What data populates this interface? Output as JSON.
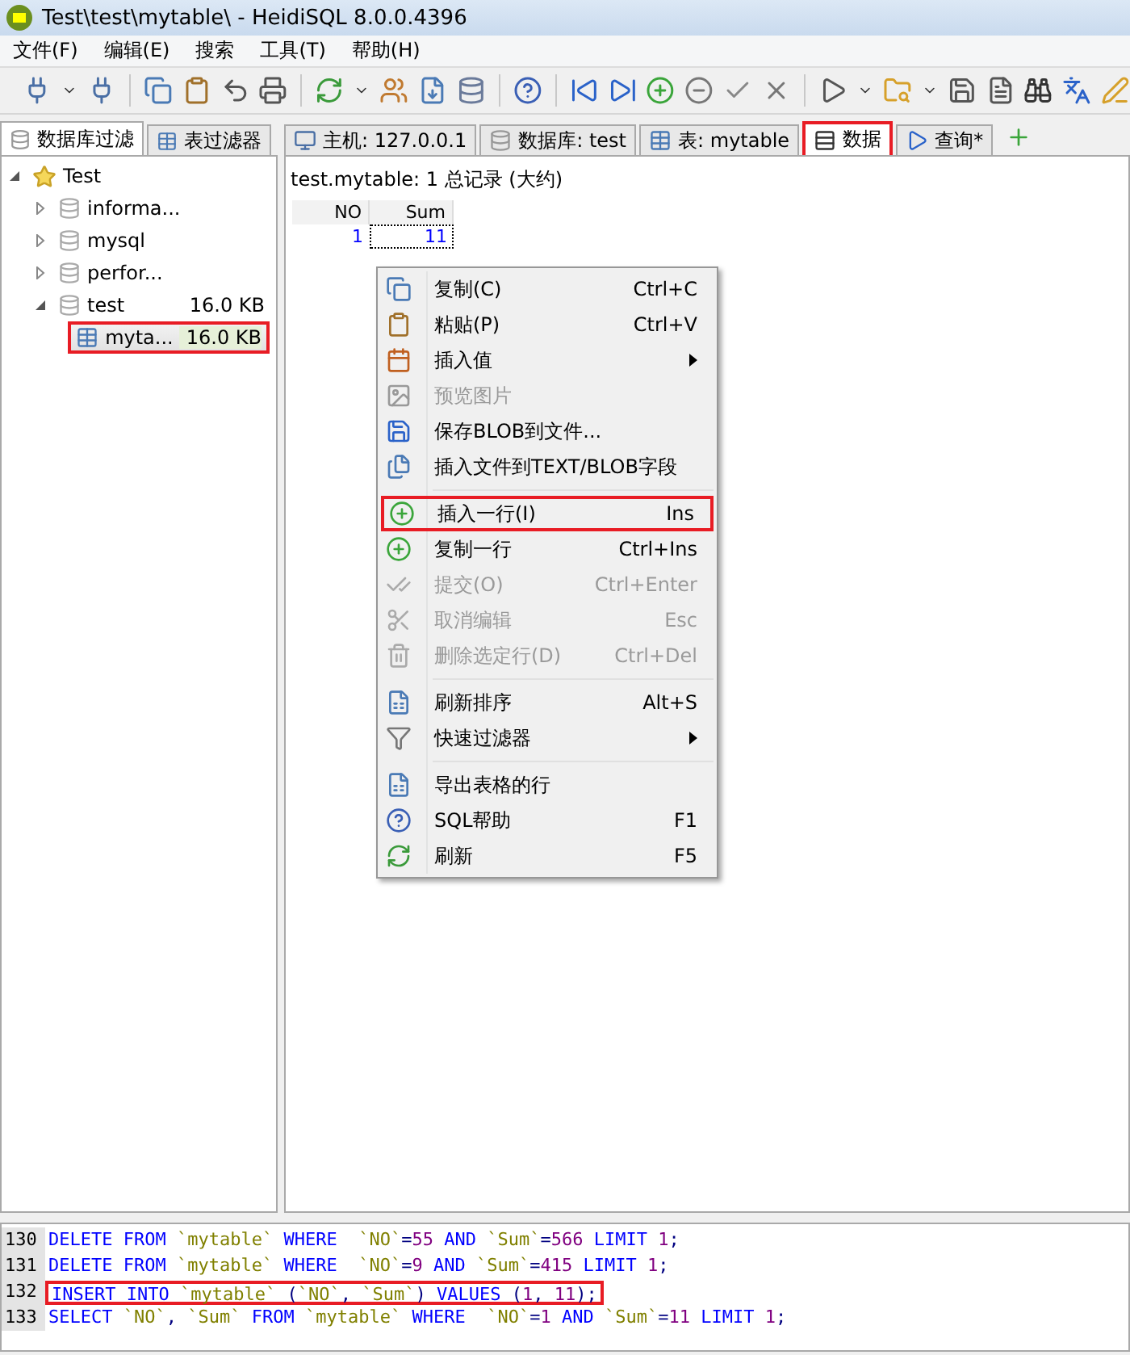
{
  "window": {
    "title": "Test\\test\\mytable\\ - HeidiSQL 8.0.0.4396"
  },
  "menu": [
    "文件(F)",
    "编辑(E)",
    "搜索",
    "工具(T)",
    "帮助(H)"
  ],
  "left_tabs": [
    {
      "label": "数据库过滤",
      "selected": true
    },
    {
      "label": "表过滤器",
      "selected": false
    }
  ],
  "tree": [
    {
      "label": "Test",
      "kind": "server",
      "expanded": true,
      "selected": false,
      "children": [
        {
          "label": "informa...",
          "kind": "database",
          "expanded": false,
          "selected": false
        },
        {
          "label": "mysql",
          "kind": "database",
          "expanded": false,
          "selected": false
        },
        {
          "label": "perfor...",
          "kind": "database",
          "expanded": false,
          "selected": false
        },
        {
          "label": "test",
          "size": "16.0 KB",
          "kind": "database",
          "expanded": true,
          "selected": false,
          "children": [
            {
              "label": "myta...",
              "size": "16.0 KB",
              "kind": "table",
              "selected": true,
              "highlighted": true
            }
          ]
        }
      ]
    }
  ],
  "tabs": [
    {
      "label": "主机: 127.0.0.1",
      "kind": "host",
      "selected": false,
      "highlighted": false
    },
    {
      "label": "数据库: test",
      "kind": "database",
      "selected": false,
      "highlighted": false
    },
    {
      "label": "表: mytable",
      "kind": "table",
      "selected": false,
      "highlighted": false
    },
    {
      "label": "数据",
      "kind": "data",
      "selected": true,
      "highlighted": true
    },
    {
      "label": "查询*",
      "kind": "query",
      "selected": false,
      "highlighted": false
    }
  ],
  "grid": {
    "caption": "test.mytable: 1 总记录 (大约)",
    "columns": [
      "NO",
      "Sum"
    ],
    "rows": [
      [
        "1",
        "11"
      ]
    ]
  },
  "context_menu": [
    {
      "kind": "item",
      "label": "复制(C)",
      "shortcut": "Ctrl+C",
      "disabled": false,
      "submenu": false,
      "highlighted": false
    },
    {
      "kind": "item",
      "label": "粘贴(P)",
      "shortcut": "Ctrl+V",
      "disabled": false,
      "submenu": false,
      "highlighted": false
    },
    {
      "kind": "item",
      "label": "插入值",
      "disabled": false,
      "submenu": true,
      "highlighted": false
    },
    {
      "kind": "item",
      "label": "预览图片",
      "disabled": true,
      "submenu": false,
      "highlighted": false
    },
    {
      "kind": "item",
      "label": "保存BLOB到文件...",
      "disabled": false,
      "submenu": false,
      "highlighted": false
    },
    {
      "kind": "item",
      "label": "插入文件到TEXT/BLOB字段",
      "disabled": false,
      "submenu": false,
      "highlighted": false
    },
    {
      "kind": "separator"
    },
    {
      "kind": "item",
      "label": "插入一行(I)",
      "shortcut": "Ins",
      "disabled": false,
      "submenu": false,
      "highlighted": true
    },
    {
      "kind": "item",
      "label": "复制一行",
      "shortcut": "Ctrl+Ins",
      "disabled": false,
      "submenu": false,
      "highlighted": false
    },
    {
      "kind": "item",
      "label": "提交(O)",
      "shortcut": "Ctrl+Enter",
      "disabled": true,
      "submenu": false,
      "highlighted": false
    },
    {
      "kind": "item",
      "label": "取消编辑",
      "shortcut": "Esc",
      "disabled": true,
      "submenu": false,
      "highlighted": false
    },
    {
      "kind": "item",
      "label": "删除选定行(D)",
      "shortcut": "Ctrl+Del",
      "disabled": true,
      "submenu": false,
      "highlighted": false
    },
    {
      "kind": "separator"
    },
    {
      "kind": "item",
      "label": "刷新排序",
      "shortcut": "Alt+S",
      "disabled": false,
      "submenu": false,
      "highlighted": false
    },
    {
      "kind": "item",
      "label": "快速过滤器",
      "disabled": false,
      "submenu": true,
      "highlighted": false
    },
    {
      "kind": "separator"
    },
    {
      "kind": "item",
      "label": "导出表格的行",
      "disabled": false,
      "submenu": false,
      "highlighted": false
    },
    {
      "kind": "item",
      "label": "SQL帮助",
      "shortcut": "F1",
      "disabled": false,
      "submenu": false,
      "highlighted": false
    },
    {
      "kind": "item",
      "label": "刷新",
      "shortcut": "F5",
      "disabled": false,
      "submenu": false,
      "highlighted": false
    }
  ],
  "log": [
    {
      "number": "130",
      "highlighted": false,
      "tokens": [
        {
          "kind": "keyword",
          "text": "DELETE FROM "
        },
        {
          "kind": "ident",
          "text": "`mytable`"
        },
        {
          "kind": "keyword",
          "text": " WHERE  "
        },
        {
          "kind": "ident",
          "text": "`NO`"
        },
        {
          "kind": "punct",
          "text": "="
        },
        {
          "kind": "number",
          "text": "55"
        },
        {
          "kind": "keyword",
          "text": " AND "
        },
        {
          "kind": "ident",
          "text": "`Sum`"
        },
        {
          "kind": "punct",
          "text": "="
        },
        {
          "kind": "number",
          "text": "566"
        },
        {
          "kind": "keyword",
          "text": " LIMIT "
        },
        {
          "kind": "number",
          "text": "1"
        },
        {
          "kind": "punct",
          "text": ";"
        }
      ]
    },
    {
      "number": "131",
      "highlighted": false,
      "tokens": [
        {
          "kind": "keyword",
          "text": "DELETE FROM "
        },
        {
          "kind": "ident",
          "text": "`mytable`"
        },
        {
          "kind": "keyword",
          "text": " WHERE  "
        },
        {
          "kind": "ident",
          "text": "`NO`"
        },
        {
          "kind": "punct",
          "text": "="
        },
        {
          "kind": "number",
          "text": "9"
        },
        {
          "kind": "keyword",
          "text": " AND "
        },
        {
          "kind": "ident",
          "text": "`Sum`"
        },
        {
          "kind": "punct",
          "text": "="
        },
        {
          "kind": "number",
          "text": "415"
        },
        {
          "kind": "keyword",
          "text": " LIMIT "
        },
        {
          "kind": "number",
          "text": "1"
        },
        {
          "kind": "punct",
          "text": ";"
        }
      ]
    },
    {
      "number": "132",
      "highlighted": true,
      "tokens": [
        {
          "kind": "keyword",
          "text": "INSERT INTO "
        },
        {
          "kind": "ident",
          "text": "`mytable`"
        },
        {
          "kind": "punct",
          "text": " ("
        },
        {
          "kind": "ident",
          "text": "`NO`"
        },
        {
          "kind": "punct",
          "text": ", "
        },
        {
          "kind": "ident",
          "text": "`Sum`"
        },
        {
          "kind": "punct",
          "text": ") "
        },
        {
          "kind": "keyword",
          "text": "VALUES"
        },
        {
          "kind": "punct",
          "text": " ("
        },
        {
          "kind": "number",
          "text": "1"
        },
        {
          "kind": "punct",
          "text": ", "
        },
        {
          "kind": "number",
          "text": "11"
        },
        {
          "kind": "punct",
          "text": ");"
        }
      ]
    },
    {
      "number": "133",
      "highlighted": false,
      "tokens": [
        {
          "kind": "keyword",
          "text": "SELECT "
        },
        {
          "kind": "ident",
          "text": "`NO`"
        },
        {
          "kind": "punct",
          "text": ", "
        },
        {
          "kind": "ident",
          "text": "`Sum`"
        },
        {
          "kind": "keyword",
          "text": " FROM "
        },
        {
          "kind": "ident",
          "text": "`mytable`"
        },
        {
          "kind": "keyword",
          "text": " WHERE  "
        },
        {
          "kind": "ident",
          "text": "`NO`"
        },
        {
          "kind": "punct",
          "text": "="
        },
        {
          "kind": "number",
          "text": "1"
        },
        {
          "kind": "keyword",
          "text": " AND "
        },
        {
          "kind": "ident",
          "text": "`Sum`"
        },
        {
          "kind": "punct",
          "text": "="
        },
        {
          "kind": "number",
          "text": "11"
        },
        {
          "kind": "keyword",
          "text": " LIMIT "
        },
        {
          "kind": "number",
          "text": "1"
        },
        {
          "kind": "punct",
          "text": ";"
        }
      ]
    }
  ]
}
